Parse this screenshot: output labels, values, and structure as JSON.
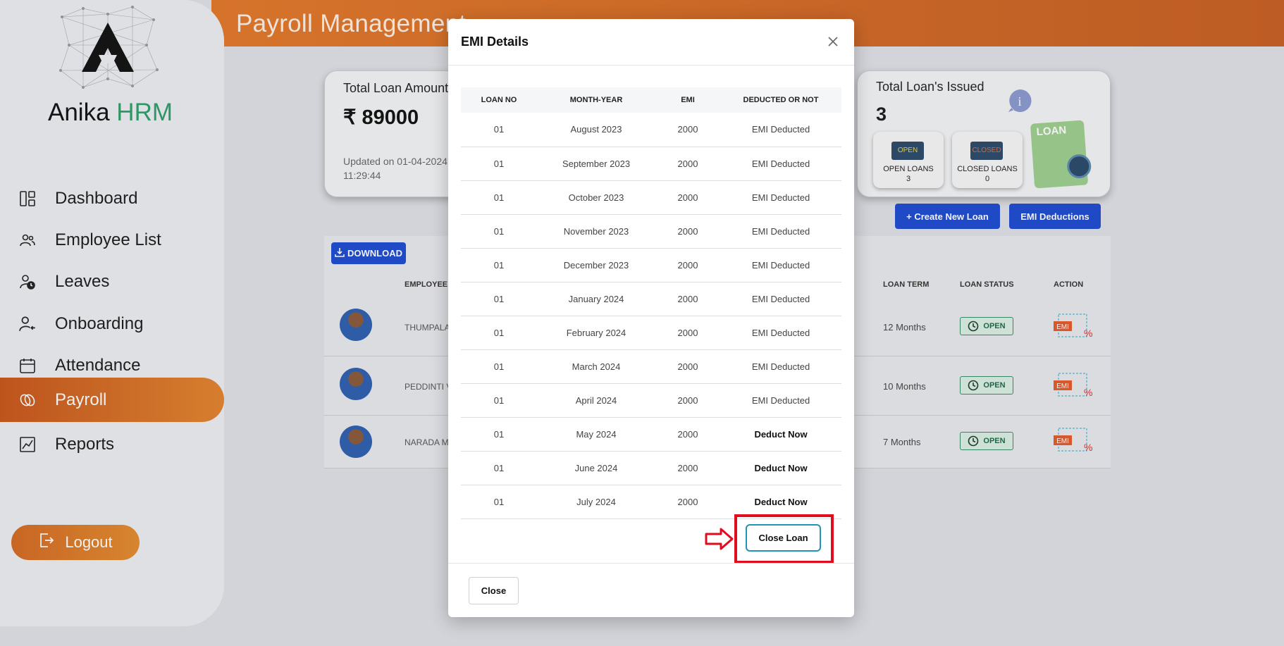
{
  "header": {
    "title": "Payroll Management"
  },
  "brand": {
    "name_part1": "Anika",
    "name_part2": "HRM"
  },
  "sidebar": {
    "items": [
      {
        "label": "Dashboard",
        "icon": "dashboard-icon"
      },
      {
        "label": "Employee List",
        "icon": "users-icon"
      },
      {
        "label": "Leaves",
        "icon": "leave-clock-icon"
      },
      {
        "label": "Onboarding",
        "icon": "onboarding-icon"
      },
      {
        "label": "Attendance",
        "icon": "calendar-icon"
      },
      {
        "label": "Payroll",
        "icon": "payroll-icon",
        "active": true
      },
      {
        "label": "Reports",
        "icon": "report-icon"
      }
    ],
    "logout": "Logout"
  },
  "summary": {
    "total_loan_label": "Total Loan Amount",
    "total_loan_value": "₹ 89000",
    "updated_text": "Updated on 01-04-2024 11:29:44",
    "issued_label": "Total Loan's Issued",
    "issued_value": "3",
    "open_loans_label": "OPEN LOANS",
    "open_loans_value": "3",
    "open_sign": "OPEN",
    "closed_loans_label": "CLOSED LOANS",
    "closed_loans_value": "0",
    "closed_sign": "CLOSED",
    "loan_art_label": "LOAN"
  },
  "actions": {
    "create_loan": "+ Create New Loan",
    "emi_deductions": "EMI Deductions",
    "download": "DOWNLOAD"
  },
  "employees_table": {
    "headers": {
      "employee": "EMPLOYEE I",
      "term": "LOAN TERM",
      "status": "LOAN STATUS",
      "action": "ACTION"
    },
    "rows": [
      {
        "name": "THUMPALA",
        "term": "12 Months",
        "status": "OPEN"
      },
      {
        "name": "PEDDINTI V",
        "term": "10 Months",
        "status": "OPEN"
      },
      {
        "name": "NARADA M",
        "term": "7 Months",
        "status": "OPEN"
      }
    ],
    "emi_icon_text": "EMI"
  },
  "modal": {
    "title": "EMI Details",
    "columns": [
      "LOAN NO",
      "MONTH-YEAR",
      "EMI",
      "DEDUCTED OR NOT"
    ],
    "rows": [
      {
        "loan_no": "01",
        "month": "August 2023",
        "emi": "2000",
        "status": "EMI Deducted"
      },
      {
        "loan_no": "01",
        "month": "September 2023",
        "emi": "2000",
        "status": "EMI Deducted"
      },
      {
        "loan_no": "01",
        "month": "October 2023",
        "emi": "2000",
        "status": "EMI Deducted"
      },
      {
        "loan_no": "01",
        "month": "November 2023",
        "emi": "2000",
        "status": "EMI Deducted"
      },
      {
        "loan_no": "01",
        "month": "December 2023",
        "emi": "2000",
        "status": "EMI Deducted"
      },
      {
        "loan_no": "01",
        "month": "January 2024",
        "emi": "2000",
        "status": "EMI Deducted"
      },
      {
        "loan_no": "01",
        "month": "February 2024",
        "emi": "2000",
        "status": "EMI Deducted"
      },
      {
        "loan_no": "01",
        "month": "March 2024",
        "emi": "2000",
        "status": "EMI Deducted"
      },
      {
        "loan_no": "01",
        "month": "April 2024",
        "emi": "2000",
        "status": "EMI Deducted"
      },
      {
        "loan_no": "01",
        "month": "May 2024",
        "emi": "2000",
        "status": "Deduct Now"
      },
      {
        "loan_no": "01",
        "month": "June 2024",
        "emi": "2000",
        "status": "Deduct Now"
      },
      {
        "loan_no": "01",
        "month": "July 2024",
        "emi": "2000",
        "status": "Deduct Now"
      }
    ],
    "close_loan": "Close Loan",
    "close": "Close"
  },
  "colors": {
    "brand_orange": "#d46a22",
    "accent_blue": "#1e4bd1",
    "highlight_red": "#e00e1c",
    "brand_green": "#2e9e6a"
  }
}
